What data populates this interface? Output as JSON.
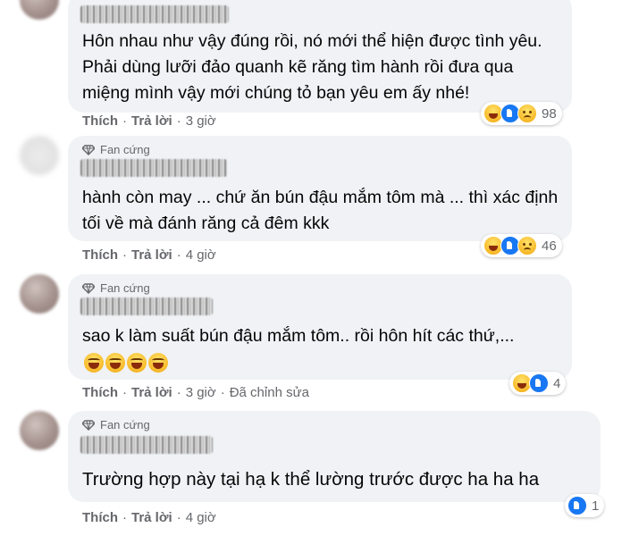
{
  "comments": [
    {
      "badge": "",
      "text": "Hôn nhau như vậy đúng rồi, nó mới thể hiện được tình yêu. Phải dùng lưỡi đảo quanh kẽ răng tìm hành rồi đưa qua miệng mình vậy mới chúng tỏ bạn yêu em ấy nhé!",
      "reaction_count": "98",
      "actions": {
        "like": "Thích",
        "reply": "Trả lời",
        "time": "3 giờ",
        "edited": ""
      }
    },
    {
      "badge": "Fan cứng",
      "text": "hành còn may ... chứ ăn bún đậu mắm tôm mà ... thì xác định tối về mà đánh răng cả đêm kkk",
      "reaction_count": "46",
      "actions": {
        "like": "Thích",
        "reply": "Trả lời",
        "time": "4 giờ",
        "edited": ""
      }
    },
    {
      "badge": "Fan cứng",
      "text": "sao k làm suất bún đậu mắm tôm.. rồi hôn hít các thứ,...",
      "emoji_count": 4,
      "reaction_count": "4",
      "actions": {
        "like": "Thích",
        "reply": "Trả lời",
        "time": "3 giờ",
        "edited": "Đã chỉnh sửa"
      }
    },
    {
      "badge": "Fan cứng",
      "text": "Trường hợp này tại hạ k thể lường trước được ha ha ha",
      "reaction_count": "1",
      "actions": {
        "like": "Thích",
        "reply": "Trả lời",
        "time": "4 giờ",
        "edited": ""
      }
    }
  ],
  "separator": "·",
  "icons": {
    "badge": "diamond-icon",
    "haha": "haha-reaction-icon",
    "like": "like-reaction-icon",
    "sad": "sad-reaction-icon"
  },
  "colors": {
    "bubble": "#f0f2f5",
    "secondary_text": "#65676b",
    "like_blue": "#1877f2"
  }
}
